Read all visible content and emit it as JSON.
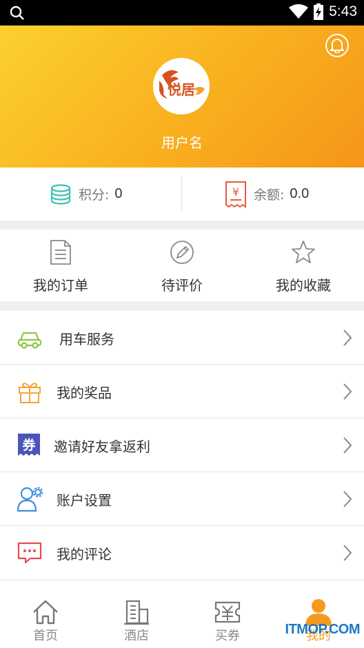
{
  "status_bar": {
    "time": "5:43",
    "icons": [
      "search-icon",
      "wifi-icon",
      "battery-icon"
    ]
  },
  "header": {
    "username": "用户名",
    "logo_text": "悦居",
    "colors": {
      "gradient_start": "#fcd030",
      "gradient_end": "#f6951a"
    }
  },
  "stats": {
    "points": {
      "label": "积分:",
      "value": "0"
    },
    "balance": {
      "label": "余额:",
      "value": "0.0",
      "icon_symbol": "¥"
    }
  },
  "orders": [
    {
      "label": "我的订单",
      "icon": "document-icon"
    },
    {
      "label": "待评价",
      "icon": "pencil-circle-icon"
    },
    {
      "label": "我的收藏",
      "icon": "star-icon"
    }
  ],
  "menu": [
    {
      "label": "用车服务",
      "icon": "car-icon",
      "color": "#8cc63f"
    },
    {
      "label": "我的奖品",
      "icon": "gift-icon",
      "color": "#f7a33b"
    },
    {
      "label": "邀请好友拿返利",
      "icon": "coupon-icon",
      "icon_text": "券",
      "color": "#4b54b8"
    },
    {
      "label": "账户设置",
      "icon": "user-settings-icon",
      "color": "#3d8fe0"
    },
    {
      "label": "我的评论",
      "icon": "comment-icon",
      "color": "#e84a50"
    }
  ],
  "tabs": [
    {
      "label": "首页",
      "icon": "home-icon"
    },
    {
      "label": "酒店",
      "icon": "building-icon"
    },
    {
      "label": "买券",
      "icon": "ticket-icon"
    },
    {
      "label": "我的",
      "icon": "user-icon",
      "active": true
    }
  ],
  "watermark": "ITMOP.COM",
  "accent_color": "#f69a1d"
}
